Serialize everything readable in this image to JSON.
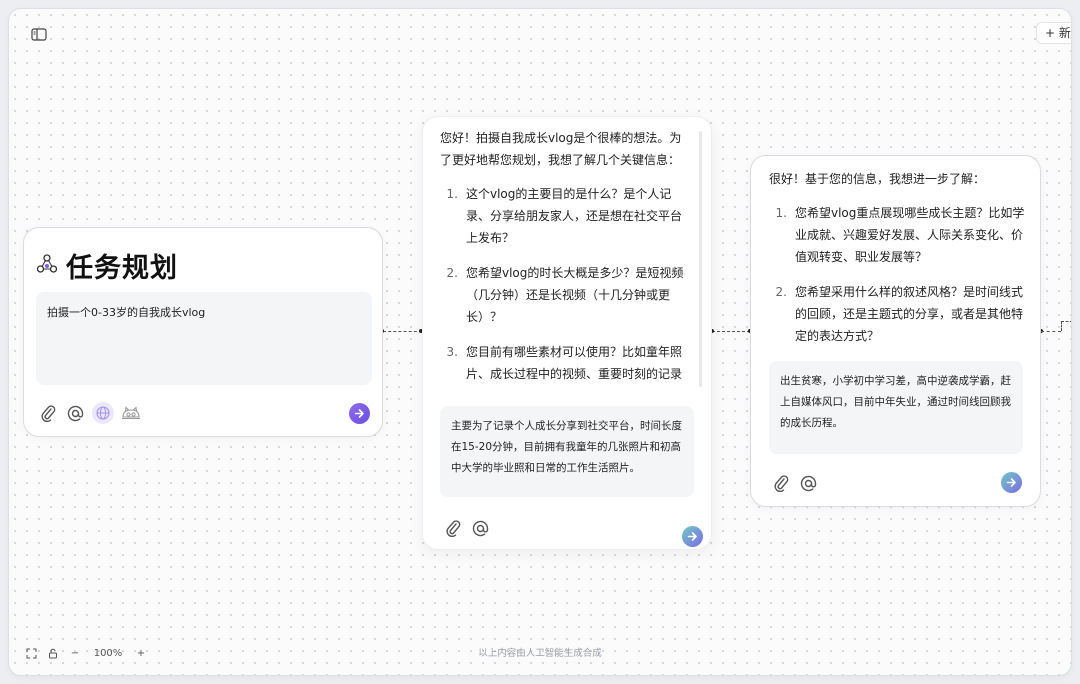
{
  "header": {
    "new_button_label": "+ 新"
  },
  "card1": {
    "title": "任务规划",
    "input_value": "拍摄一个0-33岁的自我成长vlog"
  },
  "card2": {
    "intro": "您好！拍摄自我成长vlog是个很棒的想法。为了更好地帮您规划，我想了解几个关键信息：",
    "questions": [
      {
        "num": "1.",
        "text": "这个vlog的主要目的是什么？是个人记录、分享给朋友家人，还是想在社交平台上发布？"
      },
      {
        "num": "2.",
        "text": "您希望vlog的时长大概是多少？是短视频（几分钟）还是长视频（十几分钟或更长）？"
      },
      {
        "num": "3.",
        "text": "您目前有哪些素材可以使用？比如童年照片、成长过程中的视频、重要时刻的记录等？"
      }
    ],
    "input_value": "主要为了记录个人成长分享到社交平台，时间长度在15-20分钟，目前拥有我童年的几张照片和初高中大学的毕业照和日常的工作生活照片。"
  },
  "card3": {
    "intro": "很好！基于您的信息，我想进一步了解：",
    "questions": [
      {
        "num": "1.",
        "text": "您希望vlog重点展现哪些成长主题？比如学业成就、兴趣爱好发展、人际关系变化、价值观转变、职业发展等？"
      },
      {
        "num": "2.",
        "text": "您希望采用什么样的叙述风格？是时间线式的回顾，还是主题式的分享，或者是其他特定的表达方式？"
      }
    ],
    "input_value": "出生贫寒，小学初中学习差，高中逆袭成学霸，赶上自媒体风口，目前中年失业，通过时间线回顾我的成长历程。"
  },
  "footer": {
    "zoom_minus": "−",
    "zoom_level": "100%",
    "zoom_plus": "+",
    "disclaimer": "以上内容由人工智能生成合成"
  },
  "colors": {
    "accent": "#7b5cf0",
    "send_teal": "#6fc9c2",
    "canvas_dot": "#d3d6db"
  },
  "icons": [
    "sidebar-toggle-icon",
    "task-planning-icon",
    "paperclip-icon",
    "at-icon",
    "globe-icon",
    "mascot-icon",
    "send-arrow-icon",
    "fit-screen-icon",
    "lock-icon"
  ]
}
